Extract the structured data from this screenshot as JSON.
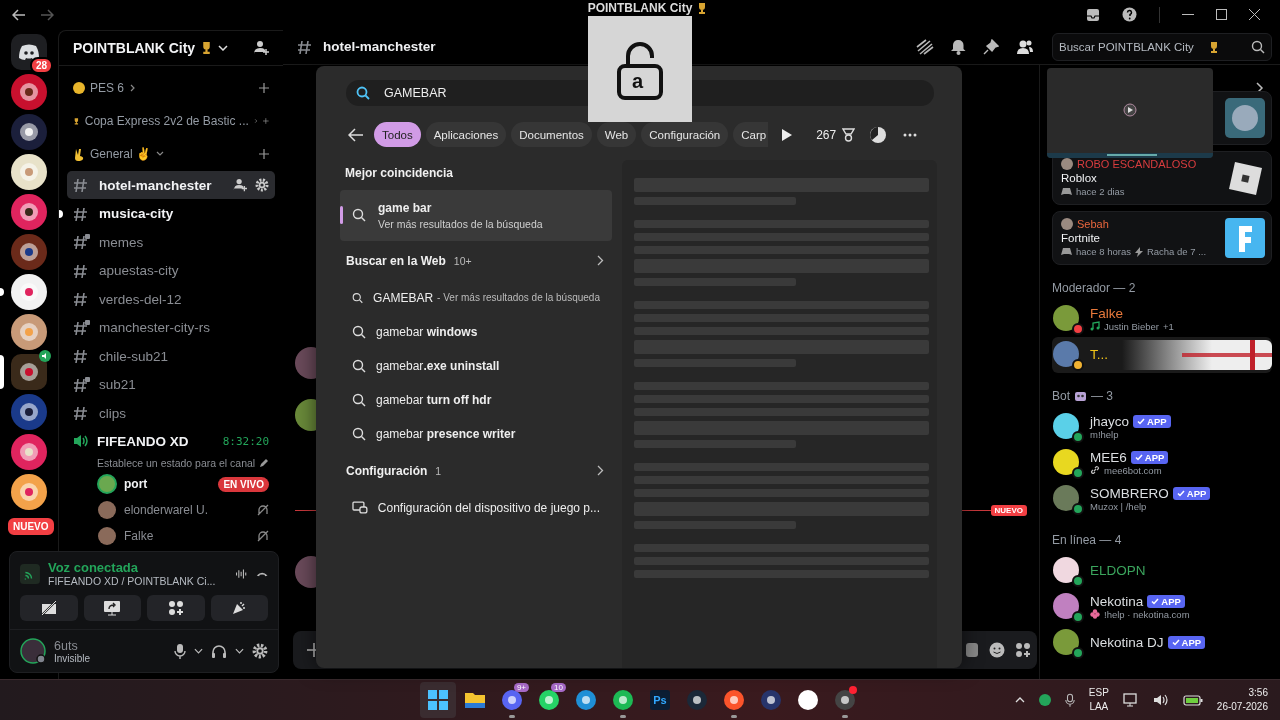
{
  "window": {
    "title": "POINTBLANK City"
  },
  "servers": [
    {
      "kind": "home",
      "badge": "28",
      "selected": false,
      "unread": false
    },
    {
      "kind": "server",
      "selected": false,
      "unread": false
    },
    {
      "kind": "server",
      "selected": false,
      "unread": false
    },
    {
      "kind": "server",
      "selected": false,
      "unread": false
    },
    {
      "kind": "server",
      "selected": false,
      "unread": false
    },
    {
      "kind": "server",
      "selected": false,
      "unread": false
    },
    {
      "kind": "server",
      "selected": false,
      "unread": true
    },
    {
      "kind": "server",
      "selected": false,
      "unread": false
    },
    {
      "kind": "voice",
      "selected": true,
      "unread": false
    },
    {
      "kind": "server",
      "selected": false,
      "unread": false
    },
    {
      "kind": "server",
      "selected": false,
      "unread": false
    },
    {
      "kind": "server",
      "selected": false,
      "unread": false
    }
  ],
  "servers_new_badge": "NUEVO",
  "sidebar": {
    "server_name": "POINTBLANK City",
    "categories": [
      {
        "name": "PES 6",
        "kind": "coin",
        "expanded": false
      },
      {
        "name": "Copa Express 2v2 de Bastic ...",
        "kind": "trophy",
        "expanded": false
      },
      {
        "name": "General ✌",
        "kind": "hand",
        "expanded": true
      }
    ],
    "channels": [
      {
        "name": "hotel-manchester",
        "selected": true,
        "unread": false,
        "locked": false
      },
      {
        "name": "musica-city",
        "selected": false,
        "unread": true,
        "locked": false
      },
      {
        "name": "memes",
        "selected": false,
        "unread": false,
        "locked": true
      },
      {
        "name": "apuestas-city",
        "selected": false,
        "unread": false,
        "locked": false
      },
      {
        "name": "verdes-del-12",
        "selected": false,
        "unread": false,
        "locked": false
      },
      {
        "name": "manchester-city-rs",
        "selected": false,
        "unread": false,
        "locked": true
      },
      {
        "name": "chile-sub21",
        "selected": false,
        "unread": false,
        "locked": false
      },
      {
        "name": "sub21",
        "selected": false,
        "unread": false,
        "locked": true
      },
      {
        "name": "clips",
        "selected": false,
        "unread": false,
        "locked": false
      }
    ],
    "voice_channel": {
      "name": "FIFEANDO XD",
      "timer": "8:32:20",
      "status": "Establece un estado para el canal",
      "users": [
        {
          "name": "port",
          "live": "EN VIVO",
          "speaking": true,
          "muted": false
        },
        {
          "name": "elonderwarel U.",
          "speaking": false,
          "muted": true
        },
        {
          "name": "Falke",
          "speaking": false,
          "muted": true
        }
      ]
    },
    "voice_panel": {
      "title": "Voz conectada",
      "subtitle": "FIFEANDO XD / POINTBLANK Ci..."
    },
    "user": {
      "name": "6uts",
      "status": "Invisible"
    }
  },
  "header": {
    "channel": "hotel-manchester",
    "search_placeholder": "Buscar POINTBLANK City"
  },
  "chat": {
    "new_divider": "NUEVO"
  },
  "caps_lock": {
    "letter": "a"
  },
  "search_panel": {
    "query": "GAMEBAR",
    "filters": [
      {
        "label": "Todos",
        "selected": true
      },
      {
        "label": "Aplicaciones",
        "selected": false
      },
      {
        "label": "Documentos",
        "selected": false
      },
      {
        "label": "Web",
        "selected": false
      },
      {
        "label": "Configuración",
        "selected": false
      },
      {
        "label": "Carp",
        "selected": false
      }
    ],
    "points": "267",
    "best_heading": "Mejor coincidencia",
    "best": {
      "title": "game bar",
      "subtitle": "Ver más resultados de la búsqueda",
      "selected": true
    },
    "web_heading": "Buscar en la Web",
    "web_count": "10+",
    "web_results": [
      {
        "kind": "query",
        "text": "GAMEBAR",
        "hint": "- Ver más resultados de la búsqueda"
      },
      {
        "kind": "suggestion",
        "text": "gamebar **windows**"
      },
      {
        "kind": "suggestion",
        "text": "gamebar**.exe uninstall**"
      },
      {
        "kind": "suggestion",
        "text": "gamebar **turn off hdr**"
      },
      {
        "kind": "suggestion",
        "text": "gamebar **presence writer**"
      }
    ],
    "settings_heading": "Configuración",
    "settings_count": "1",
    "settings_results": [
      "Configuración del dispositivo de juego p..."
    ]
  },
  "members": {
    "activities": [
      {
        "user": "ROBO ESCANDALOSO",
        "color": "#d83c3e",
        "game": "Roblox",
        "meta": "hace 2 dias",
        "kind": "roblox"
      },
      {
        "user": "Sebah",
        "color": "#e8663d",
        "game": "Fortnite",
        "meta": "hace 8 horas",
        "streak": "Racha de 7 ...",
        "kind": "fortnite"
      }
    ],
    "groups": [
      {
        "title": "Moderador — 2",
        "kind": "plain",
        "members": [
          {
            "name": "Falke",
            "color": "#e8793b",
            "status": {
              "color": "#f23f43"
            },
            "sub": {
              "kind": "music",
              "text": "Justin Bieber"
            },
            "extra": "+1",
            "banner": false
          },
          {
            "name": "T...",
            "color": "#f0c419",
            "status": {
              "color": "#f0b232"
            },
            "banner": true
          }
        ]
      },
      {
        "title": "Bot",
        "kind": "bot",
        "count": "— 3",
        "members": [
          {
            "name": "jhayco",
            "color": "#dbdee1",
            "status": {
              "color": "#23a55a"
            },
            "app": "APP",
            "sub": {
              "kind": "plain",
              "text": "m!help"
            },
            "banner": false
          },
          {
            "name": "MEE6",
            "color": "#dbdee1",
            "status": {
              "color": "#23a55a"
            },
            "app": "APP",
            "sub": {
              "kind": "link",
              "text": "mee6bot.com"
            },
            "banner": false
          },
          {
            "name": "SOMBRERO",
            "color": "#dbdee1",
            "status": {
              "color": "#23a55a"
            },
            "app": "APP",
            "sub": {
              "kind": "plain",
              "text": "Muzox | /help"
            },
            "banner": false
          }
        ]
      },
      {
        "title": "En línea — 4",
        "kind": "plain",
        "members": [
          {
            "name": "ELDOPN",
            "color": "#3ba55d",
            "status": {
              "color": "#23a55a"
            },
            "banner": false
          },
          {
            "name": "Nekotina",
            "color": "#dbdee1",
            "status": {
              "color": "#23a55a"
            },
            "app": "APP",
            "sub": {
              "kind": "flower",
              "text": "!help · nekotina.com"
            },
            "banner": false
          },
          {
            "name": "Nekotina DJ",
            "color": "#dbdee1",
            "status": {
              "color": "#23a55a"
            },
            "app": "APP",
            "banner": false
          }
        ]
      }
    ]
  },
  "taskbar": {
    "apps": [
      {
        "kind": "start",
        "running": false
      },
      {
        "kind": "folder",
        "running": false
      },
      {
        "kind": "discord",
        "badge": "9+",
        "running": true
      },
      {
        "kind": "chat",
        "badge": "10",
        "running": false
      },
      {
        "kind": "browser",
        "running": false
      },
      {
        "kind": "music",
        "running": true
      },
      {
        "kind": "ps",
        "label": "Ps",
        "running": false
      },
      {
        "kind": "steam",
        "running": false
      },
      {
        "kind": "lion",
        "running": true
      },
      {
        "kind": "game",
        "running": false
      },
      {
        "kind": "video",
        "running": false
      },
      {
        "kind": "record",
        "running": true
      }
    ],
    "language": "ESP",
    "layout": "LAA",
    "time": "3:56",
    "date": "26-07-2026"
  }
}
